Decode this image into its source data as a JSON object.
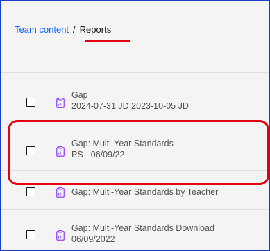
{
  "breadcrumb": {
    "team_content": "Team content",
    "separator": "/",
    "current": "Reports"
  },
  "colors": {
    "link": "#0f62fe",
    "highlight": "#e3000f",
    "icon": "#8a3ffc",
    "border": "#1a3fc4"
  },
  "reports": [
    {
      "title": "Gap",
      "subtitle": "2024-07-31 JD 2023-10-05 JD",
      "icon": "report-icon"
    },
    {
      "title": "Gap: Multi-Year Standards",
      "subtitle": "PS - 06/09/22",
      "icon": "report-icon"
    },
    {
      "title": "Gap: Multi-Year Standards by Teacher",
      "subtitle": "",
      "icon": "report-icon"
    },
    {
      "title": "Gap: Multi-Year Standards Download",
      "subtitle": "06/09/2022",
      "icon": "report-icon"
    }
  ]
}
